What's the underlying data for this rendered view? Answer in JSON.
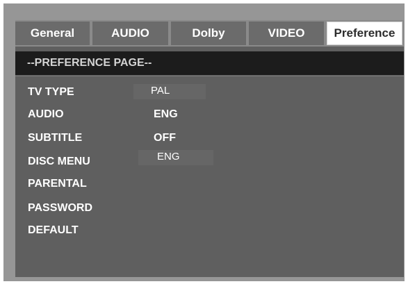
{
  "tabs": [
    {
      "label": "General"
    },
    {
      "label": "AUDIO"
    },
    {
      "label": "Dolby"
    },
    {
      "label": "VIDEO"
    },
    {
      "label": "Preference"
    }
  ],
  "page_title": "--PREFERENCE PAGE--",
  "items": [
    {
      "label": "TV TYPE",
      "value": "PAL"
    },
    {
      "label": "AUDIO",
      "value": "ENG"
    },
    {
      "label": "SUBTITLE",
      "value": "OFF"
    },
    {
      "label": "DISC MENU",
      "value": "ENG"
    },
    {
      "label": "PARENTAL"
    },
    {
      "label": "PASSWORD"
    },
    {
      "label": "DEFAULT"
    }
  ],
  "colors": {
    "screen": "#5f5f5f",
    "header": "#1c1c1c",
    "active_tab": "#ffffff"
  }
}
